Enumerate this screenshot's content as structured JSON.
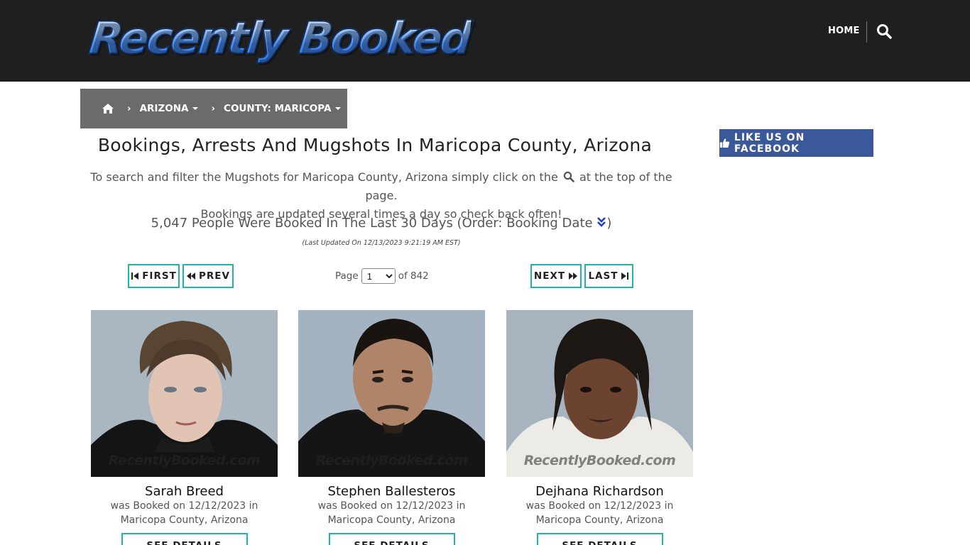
{
  "header": {
    "logo_text": "Recently Booked",
    "nav_home": "HOME"
  },
  "breadcrumb": {
    "items": [
      "ARIZONA",
      "COUNTY: MARICOPA"
    ]
  },
  "main": {
    "title": "Bookings, Arrests And Mugshots In Maricopa County, Arizona",
    "intro_part1": "To search and filter the Mugshots for Maricopa County, Arizona simply click on the",
    "intro_part2": "at the top of the page.",
    "intro_line2": "Bookings are updated several times a day so check back often!",
    "count_text": "5,047 People Were Booked In The Last 30 Days (Order: Booking Date",
    "count_close": ")",
    "updated": "(Last Updated On 12/13/2023 9:21:19 AM EST)"
  },
  "pagination": {
    "first": "FIRST",
    "prev": "PREV",
    "next": "NEXT",
    "last": "LAST",
    "page_label": "Page",
    "current_page": "1",
    "of_label": "of 842"
  },
  "sidebar": {
    "facebook": "LIKE US ON FACEBOOK"
  },
  "colors": {
    "accent_teal": "#24b1a8",
    "facebook_blue": "#3b5998",
    "header_bg": "#1f1f1f"
  },
  "bookings": [
    {
      "name": "Sarah Breed",
      "line1": "was Booked on 12/12/2023 in",
      "line2": "Maricopa County, Arizona",
      "watermark": "RecentlyBooked.com",
      "button": "SEE DETAILS"
    },
    {
      "name": "Stephen Ballesteros",
      "line1": "was Booked on 12/12/2023 in",
      "line2": "Maricopa County, Arizona",
      "watermark": "RecentlyBooked.com",
      "button": "SEE DETAILS"
    },
    {
      "name": "Dejhana Richardson",
      "line1": "was Booked on 12/12/2023 in",
      "line2": "Maricopa County, Arizona",
      "watermark": "RecentlyBooked.com",
      "button": "SEE DETAILS"
    }
  ]
}
